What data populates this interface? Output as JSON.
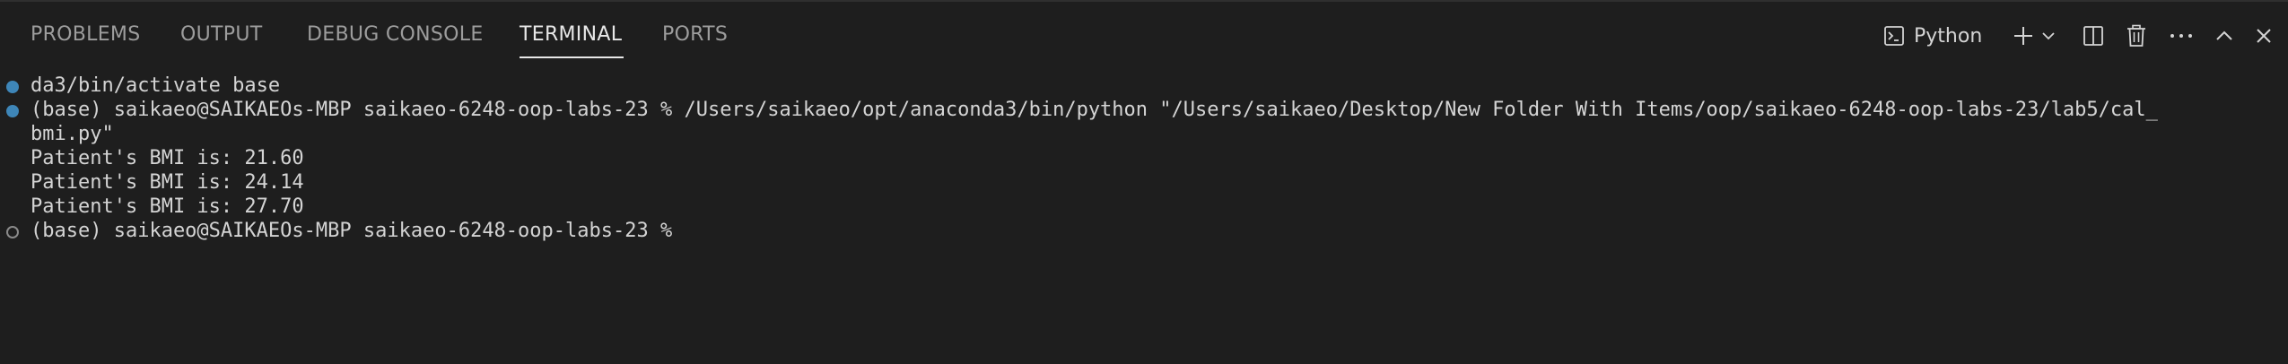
{
  "tabs": [
    {
      "label": "PROBLEMS",
      "active": false
    },
    {
      "label": "OUTPUT",
      "active": false
    },
    {
      "label": "DEBUG CONSOLE",
      "active": false
    },
    {
      "label": "TERMINAL",
      "active": true
    },
    {
      "label": "PORTS",
      "active": false
    }
  ],
  "toolbar": {
    "terminal_profile": "Python",
    "icons": [
      "terminal-icon",
      "plus-icon",
      "chevron-down-icon",
      "split-icon",
      "trash-icon",
      "more-icon",
      "chevron-up-icon",
      "close-icon"
    ]
  },
  "terminal": {
    "lines": [
      "da3/bin/activate base",
      "(base) saikaeo@SAIKAEOs-MBP saikaeo-6248-oop-labs-23 % /Users/saikaeo/opt/anaconda3/bin/python \"/Users/saikaeo/Desktop/New Folder With Items/oop/saikaeo-6248-oop-labs-23/lab5/cal_",
      "bmi.py\"",
      "Patient's BMI is: 21.60",
      "Patient's BMI is: 24.14",
      "Patient's BMI is: 27.70",
      "(base) saikaeo@SAIKAEOs-MBP saikaeo-6248-oop-labs-23 % "
    ]
  },
  "colors": {
    "background": "#1e1e1e",
    "decoration_success": "#3e86b8",
    "decoration_idle": "#8a8a8a",
    "active_tab": "#e7e7e7",
    "inactive_tab": "#9d9d9d"
  }
}
